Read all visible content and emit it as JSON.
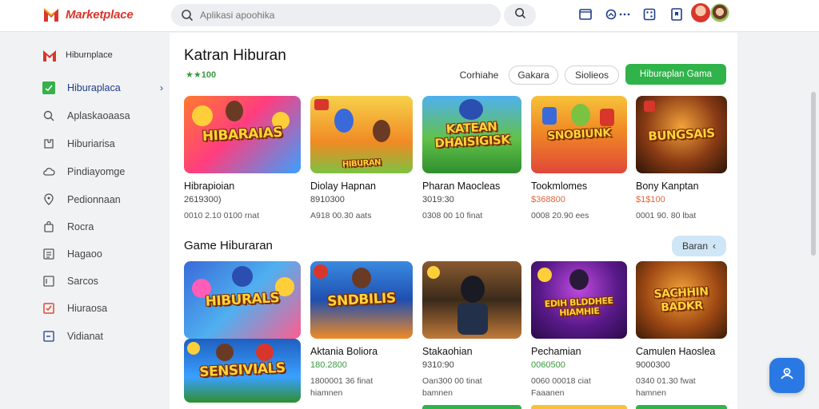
{
  "app": {
    "name": "Marketplace",
    "brand_color": "#d9362b"
  },
  "search": {
    "placeholder": "Aplikasi apoohika"
  },
  "top_icons": [
    "window-icon",
    "headset-icon",
    "more-dots-icon",
    "dice-icon",
    "bookmark-icon"
  ],
  "sidebar": {
    "brand_label": "Hiburnplace",
    "items": [
      {
        "label": "Hiburaplaca",
        "icon": "game-icon",
        "active": true
      },
      {
        "label": "Aplaskaoaasa",
        "icon": "search-icon",
        "active": false
      },
      {
        "label": "Hiburiarisa",
        "icon": "puzzle-icon",
        "active": false
      },
      {
        "label": "Pindiayomge",
        "icon": "cloud-icon",
        "active": false
      },
      {
        "label": "Pedionnaan",
        "icon": "location-icon",
        "active": false
      },
      {
        "label": "Rocra",
        "icon": "bag-icon",
        "active": false
      },
      {
        "label": "Hagaoo",
        "icon": "list-icon",
        "active": false
      },
      {
        "label": "Sarcos",
        "icon": "flag-icon",
        "active": false
      },
      {
        "label": "Hiuraosa",
        "icon": "checkbox-icon",
        "active": false
      },
      {
        "label": "Vidianat",
        "icon": "note-icon",
        "active": false
      }
    ]
  },
  "section1": {
    "title": "Katran Hiburan",
    "rating": "★★100",
    "filters": [
      "Corhiahe",
      "Gakara",
      "Siolieos"
    ],
    "cta": "Hiburaplan Gama",
    "cards": [
      {
        "thumb_text": "HIBARAIAS",
        "name": "Hibrapioian",
        "price": "2619300)",
        "meta": "0010 2.10 0100 rnat"
      },
      {
        "thumb_text": "HIBURAN",
        "name": "Diolay Hapnan",
        "price": "8910300",
        "meta": "A918 00.30 aats"
      },
      {
        "thumb_text": "KATEAN DHAISIGISK",
        "name": "Pharan Maocleas",
        "price": "3019:30",
        "meta": "0308 00 10 finat"
      },
      {
        "thumb_text": "SNOBIUNK",
        "name": "Tookmlomes",
        "price": "$368800",
        "meta": "0008 20.90 ees"
      },
      {
        "thumb_text": "BUNGSAIS",
        "name": "Bony Kanptan",
        "price": "$1$100",
        "meta": "0001 90. 80 lbat"
      }
    ]
  },
  "section2": {
    "title": "Game Hiburaran",
    "more_label": "Baran",
    "cards": [
      {
        "thumb_text": "HIBURALS",
        "name": "",
        "price": "",
        "meta": "",
        "meta2": ""
      },
      {
        "thumb_text": "SNDBILIS",
        "name": "Aktania Boliora",
        "price": "180.2800",
        "meta": "1800001 36 finat",
        "meta2": "hiamnen"
      },
      {
        "thumb_text": "",
        "name": "Stakaohian",
        "price": "9310:90",
        "meta": "Oan300 00 tinat",
        "meta2": "bamnen"
      },
      {
        "thumb_text": "EDIH BLDDHEE HIAMHIE",
        "name": "Pechamian",
        "price": "0060500",
        "meta": "0060 00018 ciat",
        "meta2": "Faaanen"
      },
      {
        "thumb_text": "SACHHIN BADKR",
        "name": "Camulen Haoslea",
        "price": "9000300",
        "meta": "0340 01.30 fwat",
        "meta2": "hamnen"
      }
    ],
    "extra_card": {
      "thumb_text": "SENSIVIALS"
    }
  }
}
